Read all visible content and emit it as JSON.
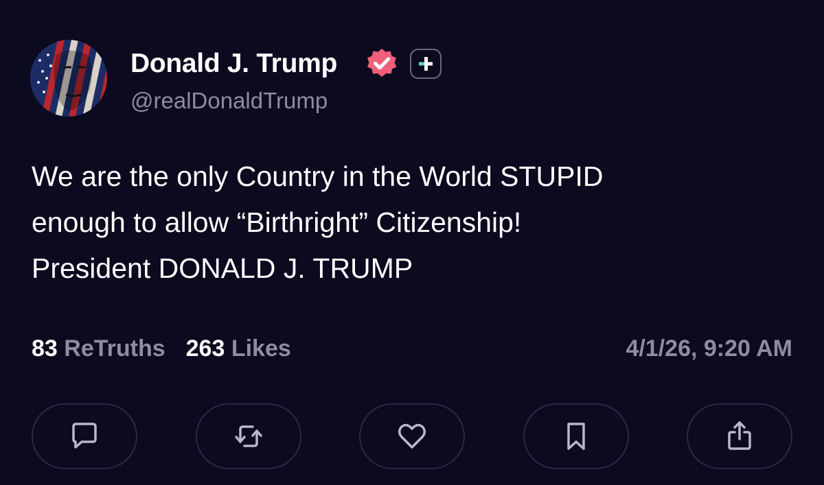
{
  "author": {
    "name": "Donald J. Trump",
    "handle": "@realDonaldTrump",
    "avatar_icon": "avatar-flag-portrait",
    "verified_icon": "verified-badge-icon",
    "plus_icon": "plus-badge-icon"
  },
  "post": {
    "lines": [
      "We are the only Country in the World STUPID",
      "enough to allow “Birthright” Citizenship!",
      "President DONALD J. TRUMP"
    ]
  },
  "stats": {
    "retruths_count": "83",
    "retruths_label": "ReTruths",
    "likes_count": "263",
    "likes_label": "Likes"
  },
  "timestamp": "4/1/26, 9:20 AM",
  "actions": [
    {
      "name": "reply",
      "icon": "reply-icon"
    },
    {
      "name": "retruth",
      "icon": "retruth-icon"
    },
    {
      "name": "like",
      "icon": "heart-icon"
    },
    {
      "name": "bookmark",
      "icon": "bookmark-icon"
    },
    {
      "name": "share",
      "icon": "share-icon"
    }
  ],
  "colors": {
    "background": "#0b0a1e",
    "text": "#ffffff",
    "muted": "#8e8d9e",
    "verified": "#f0607a",
    "plus_accent": "#5fd3c9",
    "button_border": "#2a2a40"
  }
}
